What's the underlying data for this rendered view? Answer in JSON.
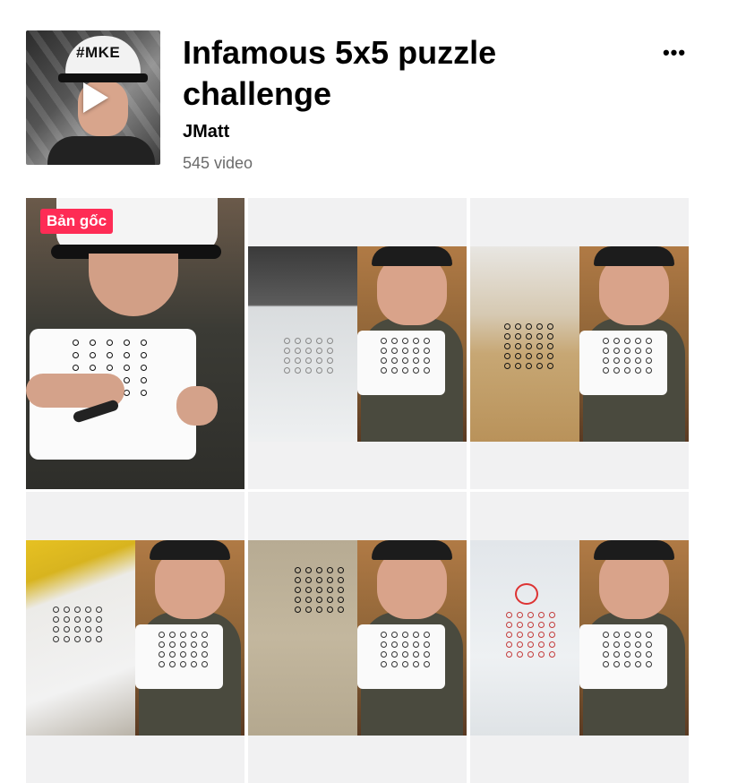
{
  "playlist": {
    "title": "Infamous 5x5 puzzle challenge",
    "author": "JMatt",
    "video_count": "545 video",
    "cover_cap_text": "#MKE",
    "more_icon": "more-horizontal-icon",
    "play_icon": "play-icon"
  },
  "videos": [
    {
      "badge": "Bản gốc",
      "style": "original"
    },
    {
      "badge": null,
      "style": "duet-white-paper"
    },
    {
      "badge": null,
      "style": "duet-brown-paper"
    },
    {
      "badge": null,
      "style": "duet-yellow-tool"
    },
    {
      "badge": null,
      "style": "duet-grid-paper"
    },
    {
      "badge": null,
      "style": "duet-red-drawing"
    },
    {
      "badge": null,
      "style": "placeholder"
    },
    {
      "badge": null,
      "style": "placeholder"
    },
    {
      "badge": null,
      "style": "placeholder"
    }
  ],
  "colors": {
    "badge": "#fe2c55",
    "card_bg": "#f1f1f2",
    "count_text": "#6b6b6b"
  }
}
